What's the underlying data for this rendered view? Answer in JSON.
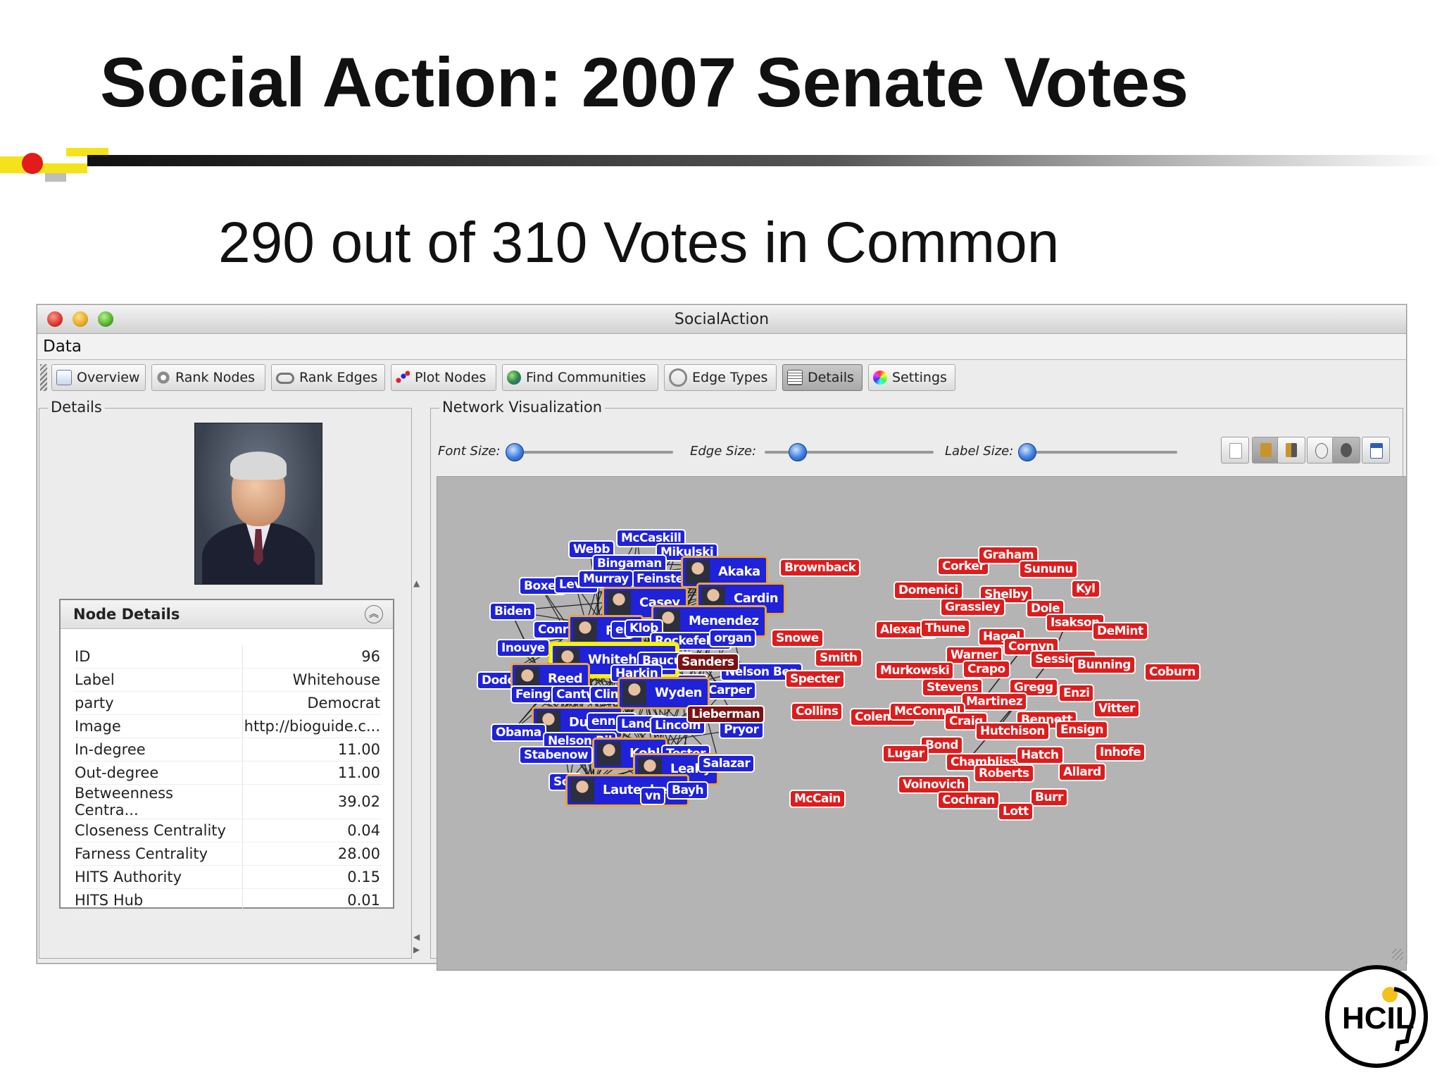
{
  "slide": {
    "title": "Social Action: 2007 Senate Votes",
    "subtitle": "290 out of 310 Votes in Common",
    "logo_text": "HCIL"
  },
  "window": {
    "title": "SocialAction",
    "menu": [
      "Data"
    ]
  },
  "toolbar": {
    "buttons": [
      {
        "label": "Overview",
        "icon": "overview-icon"
      },
      {
        "label": "Rank Nodes",
        "icon": "gear-icon"
      },
      {
        "label": "Rank Edges",
        "icon": "chain-icon"
      },
      {
        "label": "Plot Nodes",
        "icon": "scatter-icon"
      },
      {
        "label": "Find Communities",
        "icon": "globe-icon"
      },
      {
        "label": "Edge Types",
        "icon": "link-icon"
      },
      {
        "label": "Details",
        "icon": "details-icon",
        "active": true
      },
      {
        "label": "Settings",
        "icon": "color-wheel-icon"
      }
    ]
  },
  "details": {
    "panel_title": "Details",
    "node_details_title": "Node Details",
    "rows": [
      {
        "key": "ID",
        "value": "96"
      },
      {
        "key": "Label",
        "value": "Whitehouse"
      },
      {
        "key": "party",
        "value": "Democrat"
      },
      {
        "key": "Image",
        "value": "http://bioguide.c..."
      },
      {
        "key": "In-degree",
        "value": "11.00"
      },
      {
        "key": "Out-degree",
        "value": "11.00"
      },
      {
        "key": "Betweenness Centra...",
        "value": "39.02"
      },
      {
        "key": "Closeness Centrality",
        "value": "0.04"
      },
      {
        "key": "Farness Centrality",
        "value": "28.00"
      },
      {
        "key": "HITS Authority",
        "value": "0.15"
      },
      {
        "key": "HITS Hub",
        "value": "0.01"
      }
    ]
  },
  "network": {
    "panel_title": "Network Visualization",
    "font_size_label": "Font Size:",
    "edge_size_label": "Edge Size:",
    "label_size_label": "Label Size:",
    "colors": {
      "democrat": "#1f22d8",
      "republican": "#dd1d1d",
      "independent": "#7a1212",
      "selected_border": "#f7f31a",
      "canvas": "#b4b4b4"
    },
    "democrats": [
      "McCaskill",
      "Webb",
      "Mikulski",
      "Bingaman",
      "Feinstein",
      "Akaka",
      "Boxer",
      "Levin",
      "Murray",
      "Cardin",
      "Casey",
      "Biden",
      "Menendez",
      "Conra",
      "Reid",
      "er",
      "Klob",
      "Rockefeller",
      "organ",
      "Inouye",
      "Whitehouse",
      "Baucus",
      "Harkin",
      "Nelson Ben",
      "Dodd",
      "Reed",
      "yrd",
      "Carper",
      "Feingold",
      "Cantwel",
      "Clint",
      "Wyden",
      "Durbin",
      "enned",
      "Landri",
      "Lincoln",
      "Obama",
      "Pryor",
      "Nelson Bil",
      "Kohl",
      "Stabenow",
      "Tester",
      "Leahy",
      "Salazar",
      "Sch",
      "Lautenberg",
      "Bayh",
      "vn"
    ],
    "republicans": [
      "Brownback",
      "Corker",
      "Graham",
      "Sununu",
      "Domenici",
      "Shelby",
      "Kyl",
      "Grassley",
      "Dole",
      "Alexand",
      "Thune",
      "Isakson",
      "DeMint",
      "Snowe",
      "Hagel",
      "Cornyn",
      "Smith",
      "Warner",
      "Sessions",
      "Bunning",
      "Murkowski",
      "Crapo",
      "Coburn",
      "Specter",
      "Stevens",
      "Gregg",
      "Enzi",
      "Martinez",
      "Vitter",
      "Collins",
      "Coleman",
      "McConnell",
      "Craig",
      "Bennett",
      "Hutchison",
      "Ensign",
      "Bond",
      "Lugar",
      "Chambliss",
      "Hatch",
      "Inhofe",
      "Roberts",
      "Allard",
      "Voinovich",
      "McCain",
      "Cochran",
      "Burr",
      "Lott"
    ],
    "independents": [
      "Sanders",
      "Lieberman"
    ],
    "selected_node": "Whitehouse"
  }
}
